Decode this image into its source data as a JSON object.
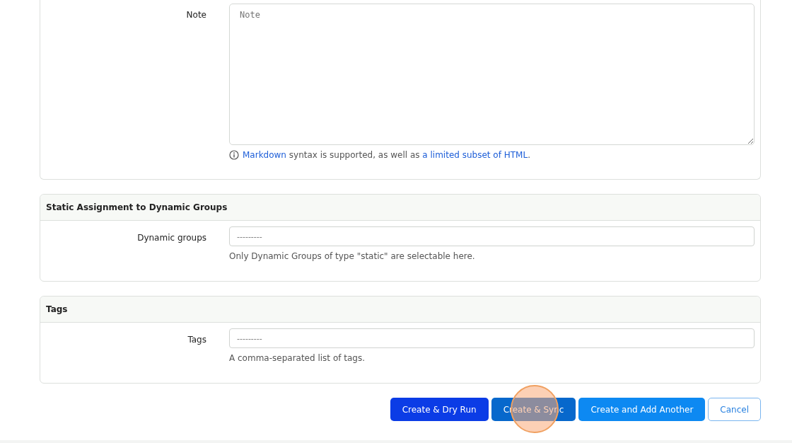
{
  "note_section": {
    "label": "Note",
    "placeholder": "Note",
    "help": [
      {
        "kind": "link",
        "text": "Markdown"
      },
      {
        "kind": "text",
        "text": " syntax is supported, as well as "
      },
      {
        "kind": "link",
        "text": "a limited subset of HTML"
      },
      {
        "kind": "text",
        "text": "."
      }
    ]
  },
  "sections": [
    {
      "title": "Static Assignment to Dynamic Groups",
      "label": "Dynamic groups",
      "placeholder": "---------",
      "help": "Only Dynamic Groups of type \"static\" are selectable here."
    },
    {
      "title": "Tags",
      "label": "Tags",
      "placeholder": "---------",
      "help": "A comma-separated list of tags."
    }
  ],
  "buttons": [
    {
      "label": "Create & Dry Run",
      "kind": "primary",
      "clicked": false
    },
    {
      "label": "Create & Sync",
      "kind": "sync",
      "clicked": true
    },
    {
      "label": "Create and Add Another",
      "kind": "info",
      "clicked": false
    },
    {
      "label": "Cancel",
      "kind": "outline",
      "clicked": false
    }
  ]
}
